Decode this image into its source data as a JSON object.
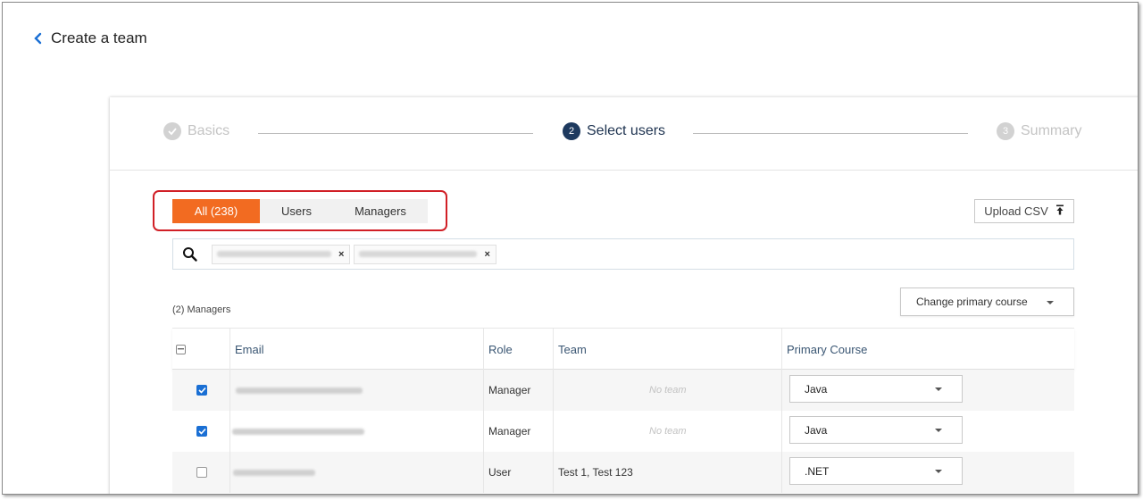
{
  "header": {
    "back_label": "Create a team"
  },
  "stepper": {
    "steps": [
      {
        "number": "",
        "label": "Basics",
        "state": "done"
      },
      {
        "number": "2",
        "label": "Select users",
        "state": "active"
      },
      {
        "number": "3",
        "label": "Summary",
        "state": "pending"
      }
    ]
  },
  "tabs": [
    {
      "label": "All (238)",
      "active": true
    },
    {
      "label": "Users",
      "active": false
    },
    {
      "label": "Managers",
      "active": false
    }
  ],
  "upload": {
    "label": "Upload CSV"
  },
  "search": {
    "chips": [
      {
        "label": ""
      },
      {
        "label": ""
      }
    ]
  },
  "list": {
    "count_label": "(2) Managers",
    "change_course_label": "Change primary course"
  },
  "table": {
    "columns": [
      "Email",
      "Role",
      "Team",
      "Primary Course"
    ],
    "rows": [
      {
        "checked": true,
        "email": "",
        "role": "Manager",
        "team": "",
        "no_team": "No team",
        "course": "Java"
      },
      {
        "checked": true,
        "email": "",
        "role": "Manager",
        "team": "",
        "no_team": "No team",
        "course": "Java"
      },
      {
        "checked": false,
        "email": "",
        "role": "User",
        "team": "Test 1, Test 123",
        "no_team": "",
        "course": ".NET"
      }
    ]
  },
  "colors": {
    "accent": "#f26b21",
    "highlight": "#d11f26",
    "step_active": "#1e3a5f",
    "checkbox": "#1a6fd4"
  }
}
